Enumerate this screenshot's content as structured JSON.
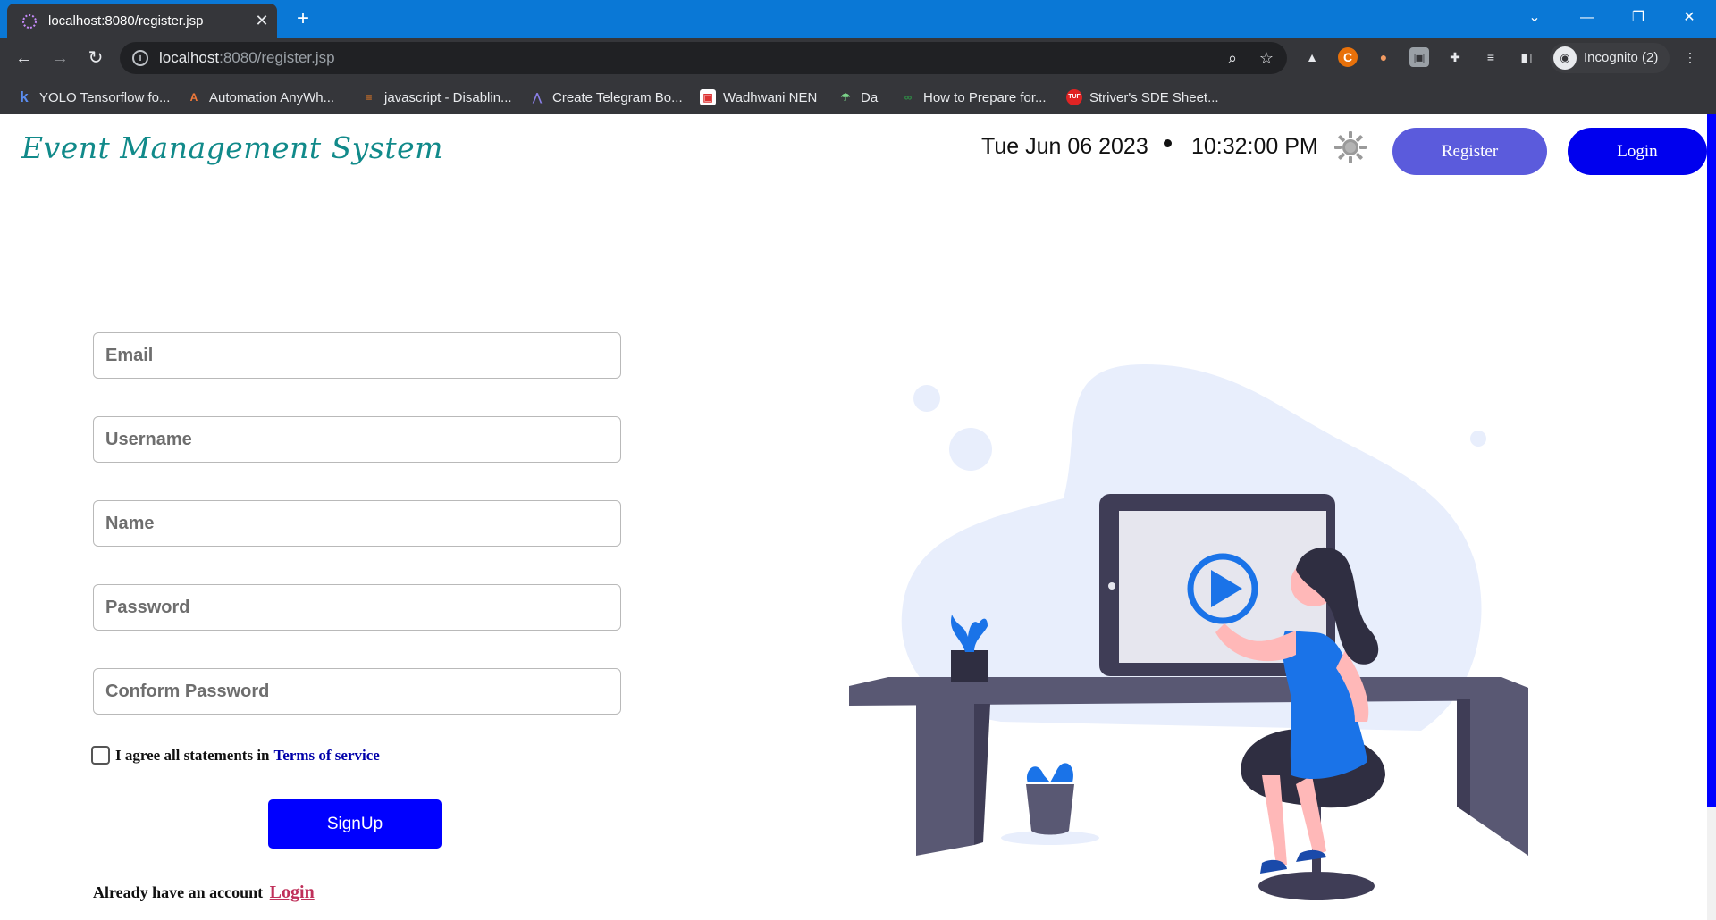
{
  "browser": {
    "tab_title": "localhost:8080/register.jsp",
    "url_host": "localhost",
    "url_path": ":8080/register.jsp",
    "incognito_label": "Incognito (2)",
    "bookmarks": [
      {
        "label": "YOLO Tensorflow fo...",
        "icon": "k"
      },
      {
        "label": "Automation AnyWh...",
        "icon": "A"
      },
      {
        "label": "javascript - Disablin...",
        "icon": "≡"
      },
      {
        "label": "Create Telegram Bo...",
        "icon": "⋀"
      },
      {
        "label": "Wadhwani NEN",
        "icon": "▣"
      },
      {
        "label": "Da",
        "icon": "☂"
      },
      {
        "label": "How to Prepare for...",
        "icon": "∞"
      },
      {
        "label": "Striver's SDE Sheet...",
        "icon": "TUF"
      }
    ]
  },
  "header": {
    "brand": "Event Management System",
    "date": "Tue Jun 06 2023",
    "time": "10:32:00 PM",
    "register_label": "Register",
    "login_label": "Login"
  },
  "form": {
    "email_placeholder": "Email",
    "username_placeholder": "Username",
    "name_placeholder": "Name",
    "password_placeholder": "Password",
    "confirm_placeholder": "Conform Password",
    "agree_text": "I agree all statements in",
    "terms_link": "Terms of service",
    "signup_label": "SignUp",
    "have_account_text": "Already have an account",
    "login_link": "Login"
  },
  "colors": {
    "brand": "#118a8a",
    "register_button": "#5b5bdc",
    "login_button": "#0000ee",
    "signup_button": "#0000ff",
    "browser_accent": "#0a78d6"
  },
  "icons": {
    "theme_toggle": "sun-icon",
    "illustration": "person-at-desk-watching-video-illustration"
  }
}
